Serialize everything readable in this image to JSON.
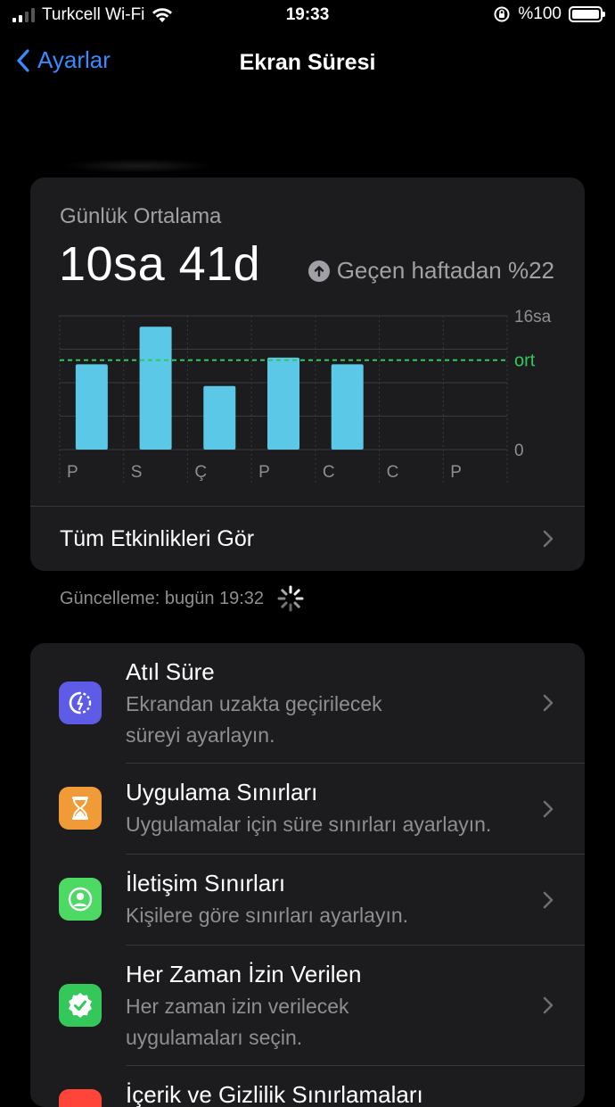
{
  "status_bar": {
    "carrier": "Turkcell Wi-Fi",
    "time": "19:33",
    "battery": "%100"
  },
  "nav": {
    "back_label": "Ayarlar",
    "title": "Ekran Süresi"
  },
  "usage": {
    "label": "Günlük Ortalama",
    "value": "10sa 41d",
    "change_text": "Geçen haftadan %22",
    "see_all": "Tüm Etkinlikleri Gör",
    "updated": "Güncelleme: bugün 19:32"
  },
  "chart_data": {
    "type": "bar",
    "categories": [
      "P",
      "S",
      "Ç",
      "P",
      "C",
      "C",
      "P"
    ],
    "values": [
      10.2,
      14.7,
      7.6,
      11.0,
      10.2,
      null,
      null
    ],
    "average": 10.7,
    "average_label": "ort",
    "ylim": [
      0,
      16
    ],
    "y_tick_labels": [
      "16sa",
      "0"
    ],
    "grid": true,
    "colors": {
      "bar": "#5ac8e6",
      "average": "#34c759",
      "grid": "#3a3a3c"
    }
  },
  "settings": [
    {
      "title": "Atıl Süre",
      "subtitle_lines": [
        "Ekrandan uzakta geçirilecek",
        "süreyi ayarlayın."
      ],
      "icon": "downtime-icon",
      "color": "#5e5ce6"
    },
    {
      "title": "Uygulama Sınırları",
      "subtitle_lines": [
        "Uygulamalar için süre sınırları ayarlayın."
      ],
      "icon": "hourglass-icon",
      "color": "#f19a38"
    },
    {
      "title": "İletişim Sınırları",
      "subtitle_lines": [
        "Kişilere göre sınırları ayarlayın."
      ],
      "icon": "person-circle-icon",
      "color": "#4cd964"
    },
    {
      "title": "Her Zaman İzin Verilen",
      "subtitle_lines": [
        "Her zaman izin verilecek",
        "uygulamaları seçin."
      ],
      "icon": "checkmark-seal-icon",
      "color": "#34c759"
    },
    {
      "title": "İçerik ve Gizlilik Sınırlamaları",
      "subtitle_lines": [],
      "icon": "restriction-icon",
      "color": "#ff453a"
    }
  ]
}
